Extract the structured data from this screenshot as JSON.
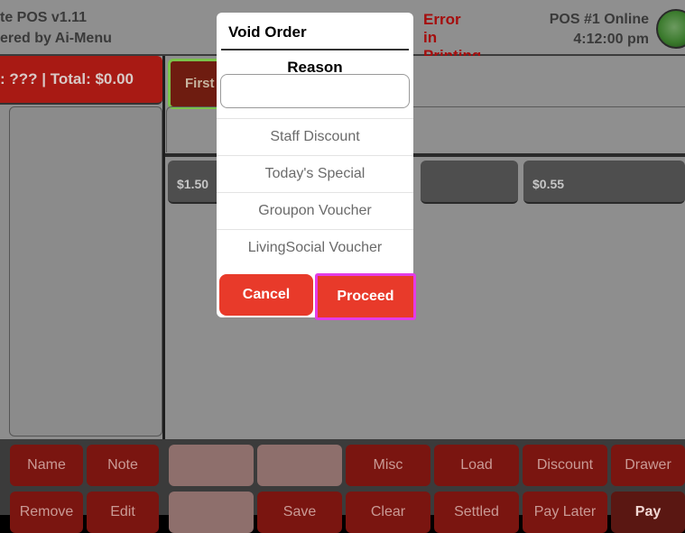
{
  "header": {
    "app_title": "te POS v1.11",
    "powered_by": "ered by Ai-Menu",
    "error_text": "Error in Printing",
    "pos_status": "POS #1 Online",
    "time": "4:12:00 pm"
  },
  "order": {
    "summary": ": ??? | Total: $0.00",
    "tab_label": "First"
  },
  "prices": [
    "$1.50",
    "$0.55"
  ],
  "bottom_row1": [
    "Name",
    "Note",
    "",
    "",
    "Misc",
    "Load",
    "Discount",
    "Drawer"
  ],
  "bottom_row2": [
    "Remove",
    "Edit",
    "",
    "Save",
    "Clear",
    "Settled",
    "Pay Later",
    "Pay"
  ],
  "modal": {
    "title": "Void Order",
    "reason_label": "Reason",
    "reason_value": "",
    "options": [
      "Staff Discount",
      "Today's Special",
      "Groupon Voucher",
      "LivingSocial Voucher"
    ],
    "cancel_label": "Cancel",
    "proceed_label": "Proceed"
  }
}
